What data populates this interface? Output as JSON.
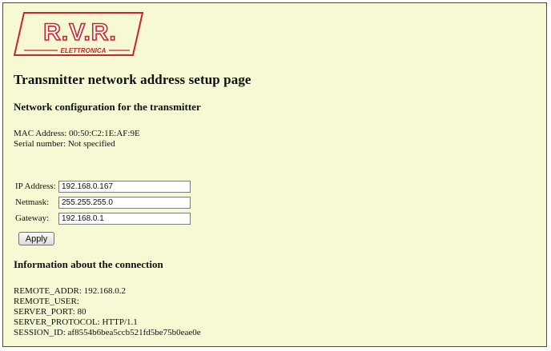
{
  "logo": {
    "main_text": "R.V.R.",
    "sub_text": "ELETTRONICA",
    "color": "#c8262b"
  },
  "page": {
    "title": "Transmitter network address setup page",
    "network_heading": "Network configuration for the transmitter",
    "mac_address": "MAC Address: 00:50:C2:1E:AF:9E",
    "serial_number": "Serial number: Not specified"
  },
  "form": {
    "ip_label": "IP Address:",
    "ip_value": "192.168.0.167",
    "netmask_label": "Netmask:",
    "netmask_value": "255.255.255.0",
    "gateway_label": "Gateway:",
    "gateway_value": "192.168.0.1",
    "apply_label": "Apply"
  },
  "connection": {
    "heading": "Information about the connection",
    "remote_addr": "REMOTE_ADDR: 192.168.0.2",
    "remote_user": "REMOTE_USER:",
    "server_port": "SERVER_PORT: 80",
    "server_protocol": "SERVER_PROTOCOL: HTTP/1.1",
    "session_id": "SESSION_ID: af8554b6bea5ccb521fd5be75b0eae0e"
  },
  "colors": {
    "page_background": "#f6f9d3",
    "frame_border": "#4b4b4b"
  }
}
